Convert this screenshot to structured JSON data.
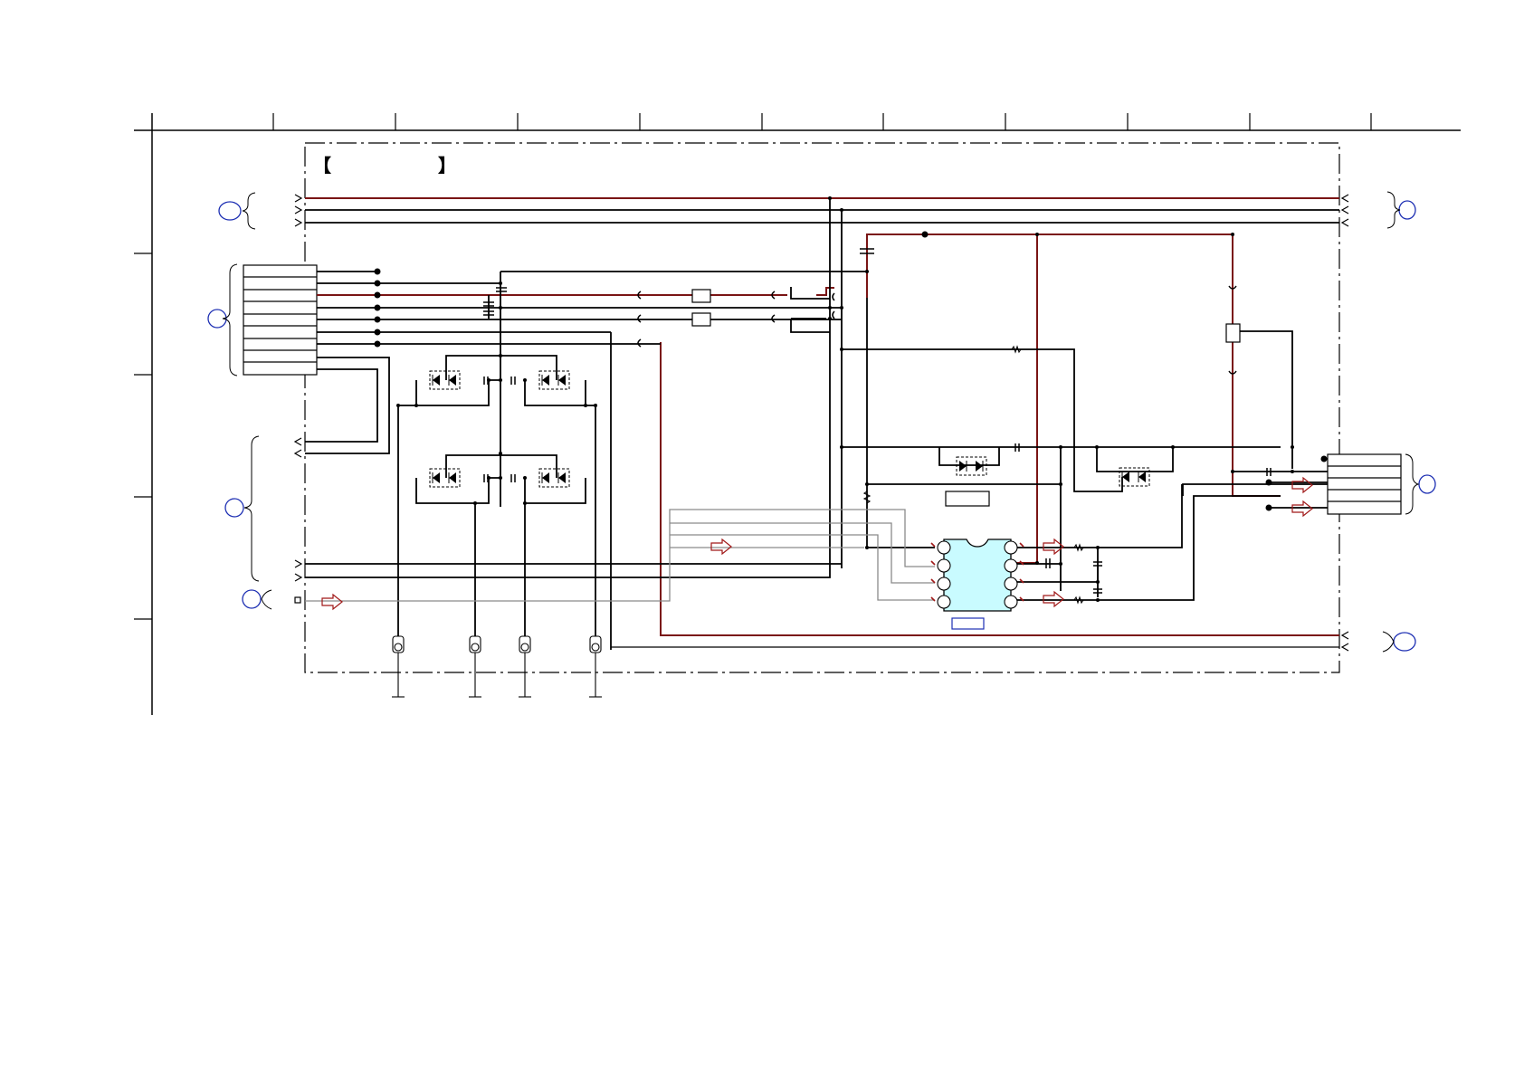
{
  "sheet": {
    "title_open": "【",
    "title_close": "】",
    "title_text": ""
  },
  "colors": {
    "background": "#ffffff",
    "wire": "#000000",
    "power_wire": "#7a1515",
    "port_circle": "#1d2fb3",
    "ic_fill": "#c9fbff",
    "signal_arrow": "#a01818",
    "grey_wire": "#8a8a8a"
  }
}
